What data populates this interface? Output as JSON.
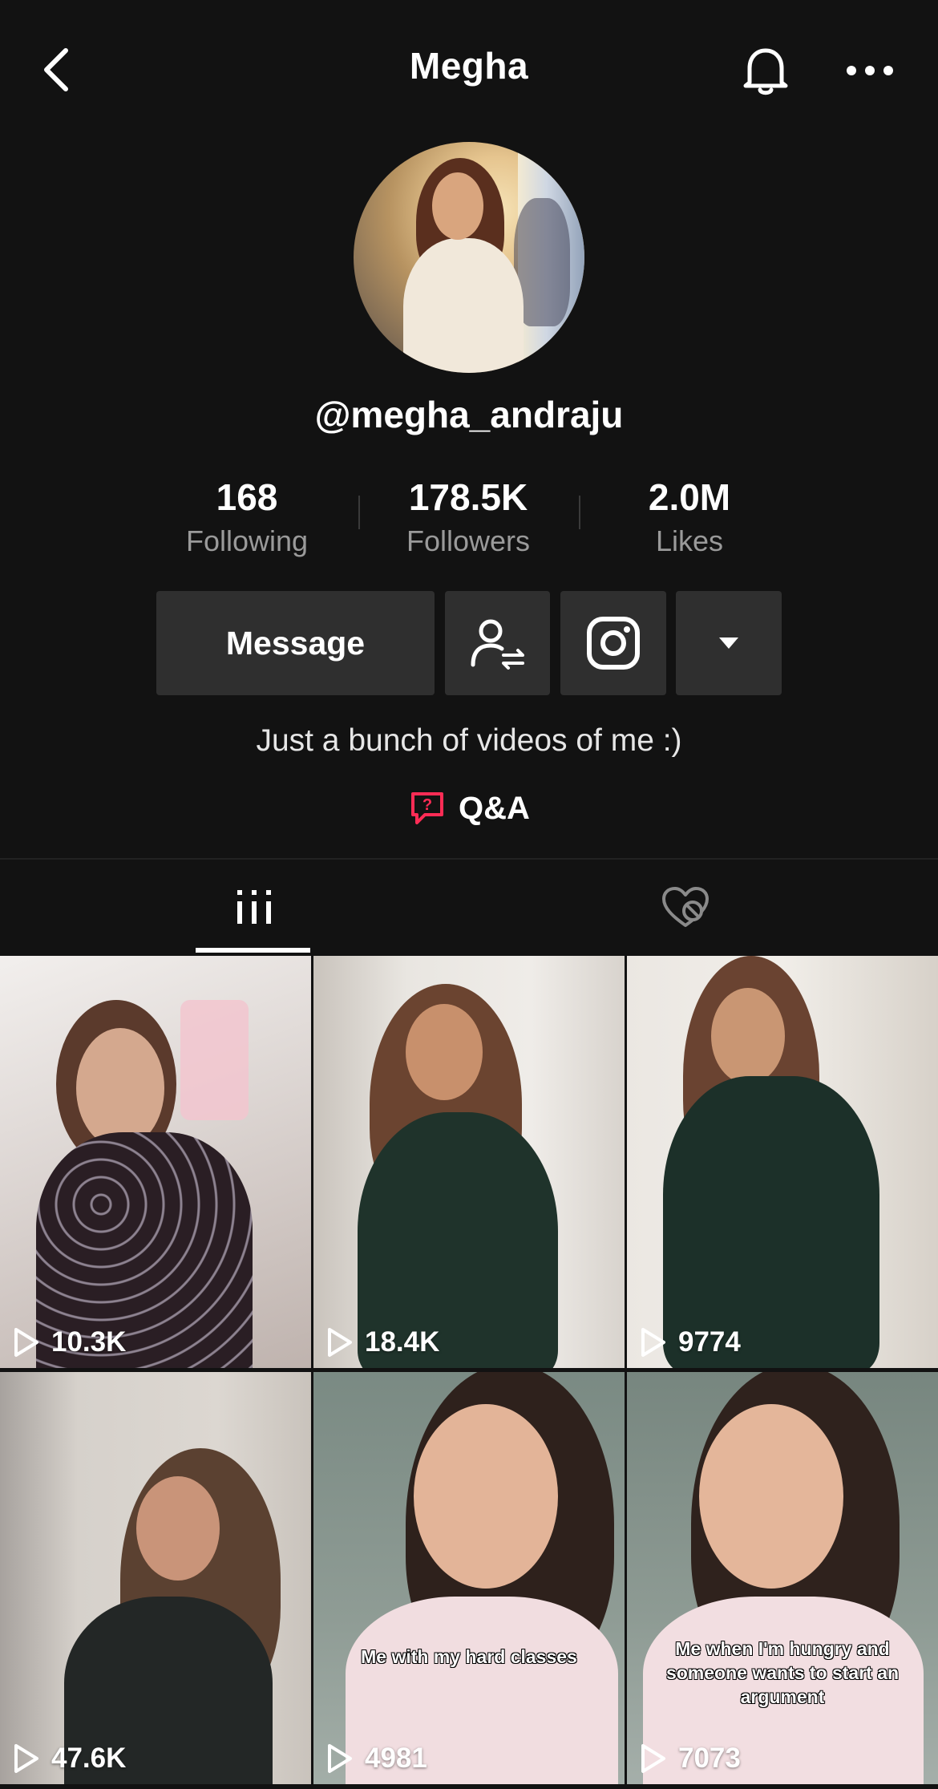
{
  "header": {
    "title": "Megha",
    "back_icon": "chevron-left-icon",
    "bell_icon": "bell-icon",
    "more_icon": "more-horizontal-icon"
  },
  "profile": {
    "username": "@megha_andraju",
    "bio": "Just a bunch of videos of me :)",
    "qa_label": "Q&A"
  },
  "stats": [
    {
      "value": "168",
      "label": "Following"
    },
    {
      "value": "178.5K",
      "label": "Followers"
    },
    {
      "value": "2.0M",
      "label": "Likes"
    }
  ],
  "actions": {
    "message_label": "Message",
    "follow_icon": "user-swap-icon",
    "instagram_icon": "instagram-icon",
    "dropdown_icon": "caret-down-icon"
  },
  "tabs": [
    {
      "icon": "grid-icon",
      "active": true
    },
    {
      "icon": "heart-hidden-icon",
      "active": false
    }
  ],
  "videos": [
    {
      "views": "10.3K",
      "caption": ""
    },
    {
      "views": "18.4K",
      "caption": ""
    },
    {
      "views": "9774",
      "caption": ""
    },
    {
      "views": "47.6K",
      "caption": ""
    },
    {
      "views": "4981",
      "caption": "Me with my hard classes"
    },
    {
      "views": "7073",
      "caption": "Me when I'm hungry and someone wants to start an argument"
    }
  ],
  "colors": {
    "background": "#121212",
    "button": "#2f2f2f",
    "qa_accent": "#fe2c55",
    "muted_text": "#9a9a9a"
  }
}
